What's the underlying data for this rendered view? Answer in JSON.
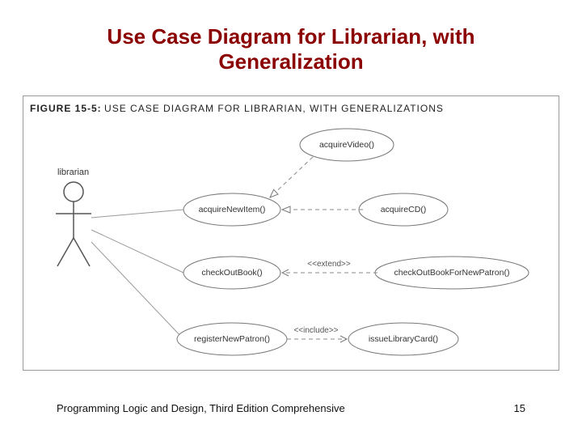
{
  "slide": {
    "title_line1": "Use Case Diagram for Librarian, with",
    "title_line2": "Generalization",
    "footer_text": "Programming Logic and Design, Third Edition Comprehensive",
    "page_number": "15"
  },
  "figure": {
    "number": "FIGURE 15-5:",
    "caption": "USE CASE DIAGRAM FOR LIBRARIAN, WITH GENERALIZATIONS"
  },
  "actor": {
    "label": "librarian"
  },
  "use_cases": {
    "acquireVideo": "acquireVideo()",
    "acquireNewItem": "acquireNewItem()",
    "acquireCD": "acquireCD()",
    "checkOutBook": "checkOutBook()",
    "checkOutBookForNewPatron": "checkOutBookForNewPatron()",
    "registerNewPatron": "registerNewPatron()",
    "issueLibraryCard": "issueLibraryCard()"
  },
  "relations": {
    "extend": "<<extend>>",
    "include": "<<include>>"
  }
}
